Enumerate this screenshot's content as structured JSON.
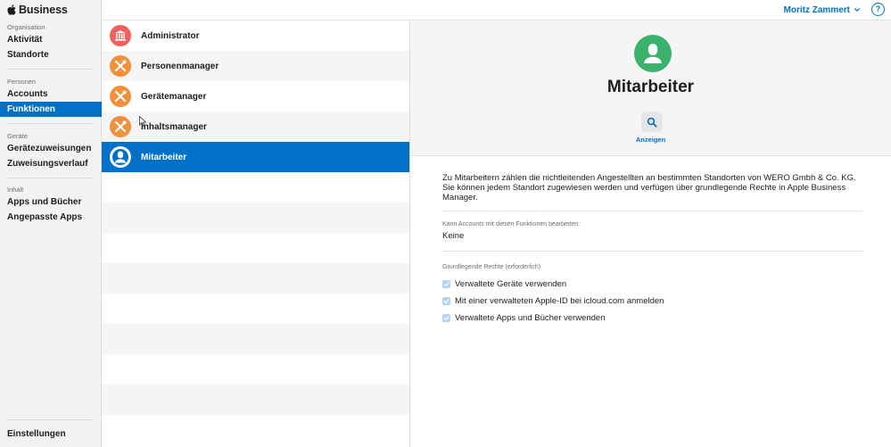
{
  "brand": {
    "name": "Business",
    "logo_icon": "apple-logo-icon"
  },
  "sidebar": {
    "sections": [
      {
        "title": "Organisation",
        "items": [
          {
            "label": "Aktivität"
          },
          {
            "label": "Standorte"
          }
        ]
      },
      {
        "title": "Personen",
        "items": [
          {
            "label": "Accounts"
          },
          {
            "label": "Funktionen",
            "active": true
          }
        ]
      },
      {
        "title": "Geräte",
        "items": [
          {
            "label": "Gerätezuweisungen"
          },
          {
            "label": "Zuweisungsverlauf"
          }
        ]
      },
      {
        "title": "Inhalt",
        "items": [
          {
            "label": "Apps und Bücher"
          },
          {
            "label": "Angepasste Apps"
          }
        ]
      }
    ],
    "footer": {
      "label": "Einstellungen"
    }
  },
  "topbar": {
    "user_name": "Moritz Zammert",
    "help_label": "?"
  },
  "roles": [
    {
      "label": "Administrator",
      "icon": "bank-icon",
      "color": "#f0605d"
    },
    {
      "label": "Personenmanager",
      "icon": "tools-icon",
      "color": "#f28f3b"
    },
    {
      "label": "Gerätemanager",
      "icon": "tools-icon",
      "color": "#f28f3b"
    },
    {
      "label": "Inhaltsmanager",
      "icon": "tools-icon",
      "color": "#f28f3b"
    },
    {
      "label": "Mitarbeiter",
      "icon": "person-icon",
      "color": "#0070c9",
      "selected": true
    }
  ],
  "detail": {
    "title": "Mitarbeiter",
    "avatar_color": "#3bb26b",
    "view_label": "Anzeigen",
    "description": "Zu Mitarbeitern zählen die nichtleitenden Angestellten an bestimmten Standorten von WERO Gmbh & Co. KG. Sie können jedem Standort zugewiesen werden und verfügen über grundlegende Rechte in Apple Business Manager.",
    "can_edit_heading": "Kann Accounts mit diesen Funktionen bearbeiten:",
    "can_edit_value": "Keine",
    "rights_heading": "Grundlegende Rechte (erforderlich)",
    "rights": [
      {
        "label": "Verwaltete Geräte verwenden",
        "checked": true
      },
      {
        "label": "Mit einer verwalteten Apple-ID bei icloud.com anmelden",
        "checked": true
      },
      {
        "label": "Verwaltete Apps und Bücher verwenden",
        "checked": true
      }
    ]
  },
  "colors": {
    "accent": "#0070c9",
    "sidebar_bg": "#f2f2f2",
    "row_alt": "#f5f5f5"
  }
}
